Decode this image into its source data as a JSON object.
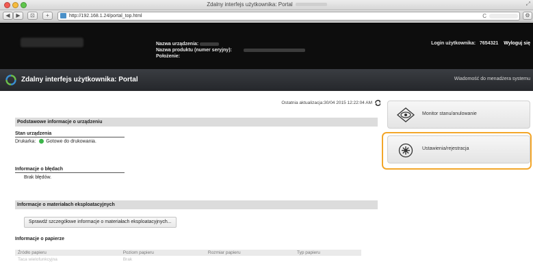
{
  "window": {
    "title": "Zdalny interfejs użytkownika: Portal"
  },
  "toolbar": {
    "url": "http://192.168.1.24/portal_top.html",
    "reload": "C"
  },
  "header": {
    "info_labels": [
      "Nazwa urządzenia:",
      "Nazwa produktu (numer seryjny):",
      "Położenie:"
    ],
    "login_label": "Login użytkownika:",
    "login_value": "7654321",
    "logout": "Wyloguj się"
  },
  "portal": {
    "title": "Zdalny interfejs użytkownika: Portal",
    "admin_message": "Wiadomość do menadżera systemu"
  },
  "main": {
    "last_update": "Ostatnia aktualizacja:30/04 2015 12:22:04 AM",
    "basic_info_header": "Podstawowe informacje o urządzeniu",
    "device_status_header": "Stan urządzenia",
    "printer_label": "Drukarka:",
    "printer_status": "Gotowe do drukowania.",
    "errors_header": "Informacje o błędach",
    "errors_text": "Brak błędów.",
    "consumables_header": "Informacje o materiałach eksploatacyjnych",
    "consumables_button": "Sprawdź szczegółowe informacje o materiałach eksploatacyjnych...",
    "paper_header": "Informacje o papierze",
    "paper_table": {
      "columns": [
        "Źródło papieru",
        "Poziom papieru",
        "Rozmiar papieru",
        "Typ papieru"
      ],
      "rows": [
        [
          "Taca wielofunkcyjna",
          "Brak",
          "",
          ""
        ]
      ]
    }
  },
  "side": {
    "monitor_label": "Monitor stanu/anulowanie",
    "settings_label": "Ustawienia/rejestracja"
  },
  "colors": {
    "highlight": "#f3a629",
    "status_ready": "#3bb54a"
  }
}
